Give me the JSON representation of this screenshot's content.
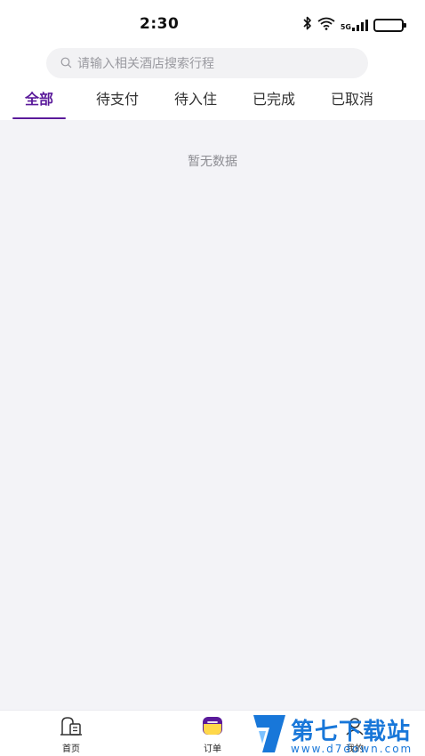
{
  "status_bar": {
    "time": "2:30",
    "network_label": "5G",
    "icons": [
      "bluetooth-icon",
      "wifi-icon",
      "signal-icon",
      "battery-icon"
    ]
  },
  "search": {
    "placeholder": "请输入相关酒店搜索行程",
    "icon": "search-icon"
  },
  "tabs": [
    {
      "label": "全部",
      "active": true
    },
    {
      "label": "待支付",
      "active": false
    },
    {
      "label": "待入住",
      "active": false
    },
    {
      "label": "已完成",
      "active": false
    },
    {
      "label": "已取消",
      "active": false
    }
  ],
  "empty_state": {
    "text": "暂无数据"
  },
  "bottom_nav": [
    {
      "label": "首页",
      "icon": "home-icon"
    },
    {
      "label": "订单",
      "icon": "order-icon",
      "active": true
    },
    {
      "label": "我的",
      "icon": "profile-icon"
    }
  ],
  "watermark": {
    "title": "第七下载站",
    "url": "www.d7down.com"
  },
  "colors": {
    "accent": "#5a1a9a",
    "background": "#f3f3f7",
    "watermark": "#1877d9"
  }
}
